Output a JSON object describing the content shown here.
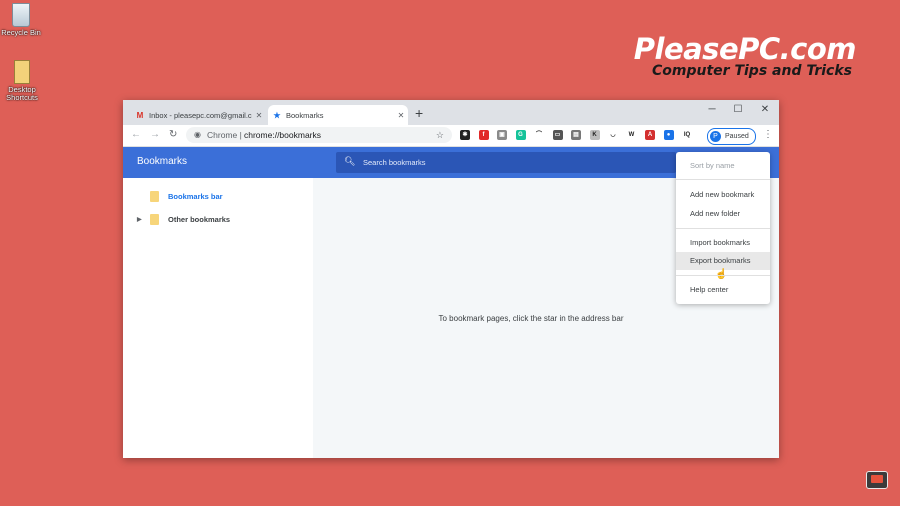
{
  "desktop": {
    "icons": [
      {
        "label": "Recycle Bin"
      },
      {
        "label": "Desktop Shortcuts"
      }
    ]
  },
  "brand": {
    "title": "PleasePC.com",
    "subtitle": "Computer Tips and Tricks"
  },
  "browser": {
    "tabs": [
      {
        "title": "Inbox - pleasepc.com@gmail.co",
        "icon": "gmail-icon"
      },
      {
        "title": "Bookmarks",
        "icon": "star-icon",
        "active": true
      }
    ],
    "window_controls": {
      "minimize": "─",
      "maximize": "☐",
      "close": "✕"
    },
    "toolbar": {
      "back": "←",
      "forward": "→",
      "reload": "↻",
      "omnibox_site": "Chrome  |",
      "omnibox_url": "chrome://bookmarks",
      "profile_initial": "P",
      "profile_label": "Paused",
      "extensions": [
        {
          "name": "black-ext",
          "color": "#222222",
          "glyph": "✱"
        },
        {
          "name": "flipboard-ext",
          "color": "#e12828",
          "glyph": "f"
        },
        {
          "name": "grey-box-ext",
          "color": "#8a8a8a",
          "glyph": "▣"
        },
        {
          "name": "grammarly-ext",
          "color": "#15c39a",
          "glyph": "G"
        },
        {
          "name": "arc-ext",
          "color": "#ffffff",
          "glyph": "⌒"
        },
        {
          "name": "black-box-ext",
          "color": "#555555",
          "glyph": "▭"
        },
        {
          "name": "reader-ext",
          "color": "#777777",
          "glyph": "▤"
        },
        {
          "name": "k-ext",
          "color": "#bdbdbd",
          "glyph": "K"
        },
        {
          "name": "pocket-ext",
          "color": "#ffffff",
          "glyph": "◡"
        },
        {
          "name": "w-ext",
          "color": "#ffffff",
          "glyph": "W"
        },
        {
          "name": "pdf-ext",
          "color": "#d32f2f",
          "glyph": "A"
        },
        {
          "name": "camera-ext",
          "color": "#1a73e8",
          "glyph": "●"
        },
        {
          "name": "iq-ext",
          "color": "#ffffff",
          "glyph": "IQ"
        }
      ]
    },
    "app": {
      "title": "Bookmarks",
      "search_placeholder": "Search bookmarks",
      "tree": [
        {
          "label": "Bookmarks bar",
          "selected": true
        },
        {
          "label": "Other bookmarks",
          "selected": false
        }
      ],
      "empty_message": "To bookmark pages, click the star in the address bar",
      "menu": {
        "sort": "Sort by name",
        "add_bookmark": "Add new bookmark",
        "add_folder": "Add new folder",
        "import": "Import bookmarks",
        "export": "Export bookmarks",
        "help": "Help center"
      }
    }
  }
}
